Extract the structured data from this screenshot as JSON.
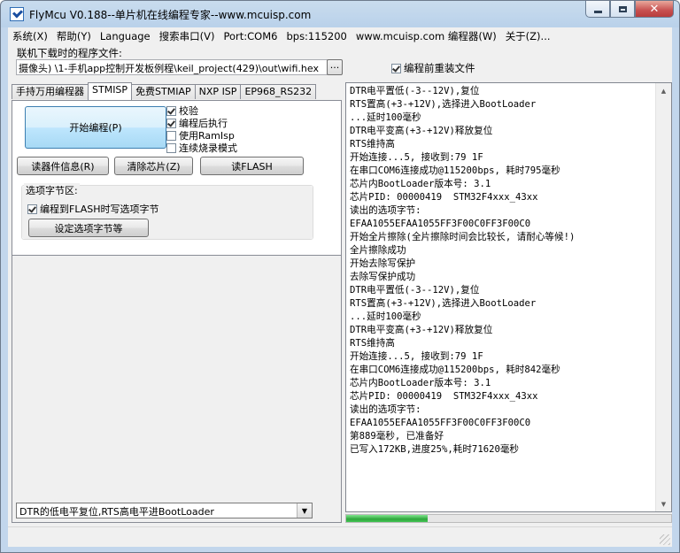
{
  "window": {
    "title": "FlyMcu V0.188--单片机在线编程专家--www.mcuisp.com"
  },
  "menu": [
    "系统(X)",
    "帮助(Y)",
    "Language",
    "搜索串口(V)",
    "Port:COM6",
    "bps:115200",
    "www.mcuisp.com 编程器(W)",
    "关于(Z)..."
  ],
  "file": {
    "label": "联机下载时的程序文件:",
    "path": "摄像头) \\1-手机app控制开发板例程\\keil_project(429)\\out\\wifi.hex",
    "browse_label": "...",
    "reload_label": "编程前重装文件",
    "reload_checked": true
  },
  "tabs": [
    "手持万用编程器",
    "STMISP",
    "免费STMIAP",
    "NXP ISP",
    "EP968_RS232"
  ],
  "active_tab": "STMISP",
  "stmisp": {
    "start_button": "开始编程(P)",
    "options": [
      {
        "label": "校验",
        "checked": true
      },
      {
        "label": "编程后执行",
        "checked": true
      },
      {
        "label": "使用RamIsp",
        "checked": false
      },
      {
        "label": "连续烧录模式",
        "checked": false
      }
    ],
    "read_info_button": "读器件信息(R)",
    "erase_button": "清除芯片(Z)",
    "read_flash_button": "读FLASH",
    "option_bytes": {
      "title": "选项字节区:",
      "write_on_flash_label": "编程到FLASH时写选项字节",
      "write_on_flash_checked": true,
      "set_button": "设定选项字节等"
    }
  },
  "reset_mode": "DTR的低电平复位,RTS高电平进BootLoader",
  "log_lines": [
    "DTR电平置低(-3--12V),复位",
    "RTS置高(+3-+12V),选择进入BootLoader",
    "...延时100毫秒",
    "DTR电平变高(+3-+12V)释放复位",
    "RTS维持高",
    "开始连接...5, 接收到:79 1F",
    "在串口COM6连接成功@115200bps, 耗时795毫秒",
    "芯片内BootLoader版本号: 3.1",
    "芯片PID: 00000419  STM32F4xxx_43xx",
    "读出的选项字节:",
    "EFAA1055EFAA1055FF3F00C0FF3F00C0",
    "开始全片擦除(全片擦除时间会比较长, 请耐心等候!)",
    "全片擦除成功",
    "开始去除写保护",
    "去除写保护成功",
    "DTR电平置低(-3--12V),复位",
    "RTS置高(+3-+12V),选择进入BootLoader",
    "...延时100毫秒",
    "DTR电平变高(+3-+12V)释放复位",
    "RTS维持高",
    "开始连接...5, 接收到:79 1F",
    "在串口COM6连接成功@115200bps, 耗时842毫秒",
    "芯片内BootLoader版本号: 3.1",
    "芯片PID: 00000419  STM32F4xxx_43xx",
    "读出的选项字节:",
    "EFAA1055EFAA1055FF3F00C0FF3F00C0",
    "第889毫秒, 已准备好",
    "已写入172KB,进度25%,耗时71620毫秒"
  ],
  "progress": 0.25,
  "colors": {
    "progress_green": "#2ea63c",
    "close_red": "#c75050"
  }
}
